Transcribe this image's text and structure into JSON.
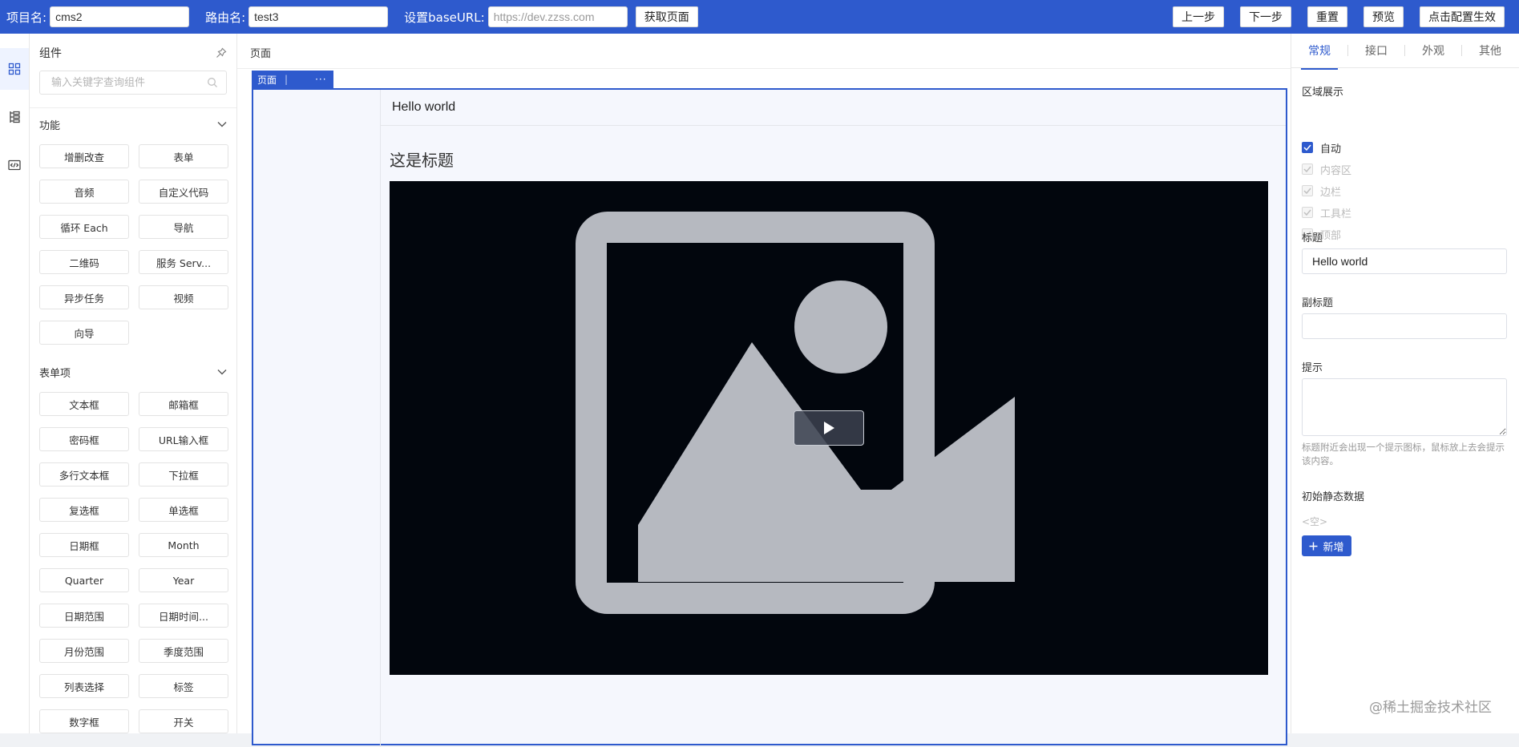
{
  "topbar": {
    "project_label": "项目名:",
    "project_value": "cms2",
    "route_label": "路由名:",
    "route_value": "test3",
    "baseurl_label": "设置baseURL:",
    "baseurl_placeholder": "https://dev.zzss.com",
    "fetch_button": "获取页面",
    "prev_button": "上一步",
    "next_button": "下一步",
    "reset_button": "重置",
    "preview_button": "预览",
    "apply_button": "点击配置生效"
  },
  "rail": {
    "items": [
      "components-grid-icon",
      "outline-tree-icon",
      "code-icon"
    ]
  },
  "components": {
    "title": "组件",
    "search_placeholder": "输入关键字查询组件",
    "sections": [
      {
        "title": "功能",
        "items": [
          "增删改查",
          "表单",
          "音频",
          "自定义代码",
          "循环 Each",
          "导航",
          "二维码",
          "服务 Serv...",
          "异步任务",
          "视频",
          "向导"
        ]
      },
      {
        "title": "表单项",
        "items": [
          "文本框",
          "邮箱框",
          "密码框",
          "URL输入框",
          "多行文本框",
          "下拉框",
          "复选框",
          "单选框",
          "日期框",
          "Month",
          "Quarter",
          "Year",
          "日期范围",
          "日期时间...",
          "月份范围",
          "季度范围",
          "列表选择",
          "标签",
          "数字框",
          "开关"
        ]
      }
    ]
  },
  "canvas": {
    "breadcrumb": "页面",
    "selected_tag": "页面",
    "selected_sep": "|",
    "selected_more": "···",
    "page_header": "Hello world",
    "content_title": "这是标题"
  },
  "props": {
    "tabs": [
      "常规",
      "接口",
      "外观",
      "其他"
    ],
    "active_tab": 0,
    "region_label": "区域展示",
    "regions": [
      {
        "label": "自动",
        "checked": true,
        "disabled": false
      },
      {
        "label": "内容区",
        "checked": true,
        "disabled": true
      },
      {
        "label": "边栏",
        "checked": true,
        "disabled": true
      },
      {
        "label": "工具栏",
        "checked": true,
        "disabled": true
      },
      {
        "label": "顶部",
        "checked": true,
        "disabled": true
      }
    ],
    "title_label": "标题",
    "title_value": "Hello world",
    "subtitle_label": "副标题",
    "subtitle_value": "",
    "tip_label": "提示",
    "tip_value": "",
    "tip_hint": "标题附近会出现一个提示图标，鼠标放上去会提示该内容。",
    "static_data_label": "初始静态数据",
    "static_data_empty": "<空>",
    "add_button": "新增"
  },
  "watermark": "@稀土掘金技术社区",
  "colors": {
    "accent": "#2e5acd",
    "video_bg": "#02060d",
    "placeholder_image": "#b6b9c0"
  }
}
